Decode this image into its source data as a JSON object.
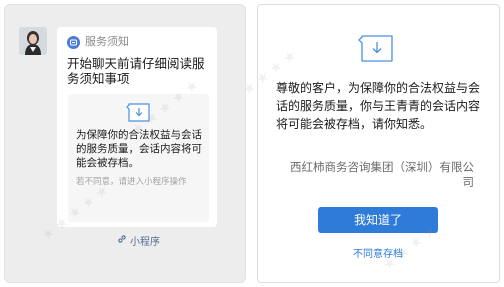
{
  "chat_preview": {
    "service_name": "服务须知",
    "title": "开始聊天前请仔细阅读服务须知事项",
    "card_text": "为保障你的合法权益与会话的服务质量，会话内容将可能会被存档。",
    "card_note": "若不同意，请进入小程序操作",
    "mini_program_label": "小程序"
  },
  "dialog": {
    "notice": "尊敬的客户，为保障你的合法权益与会话的服务质量，你与王青青的会话内容将可能会被存档，请你知悉。",
    "company": "西红柿商务咨询集团（深圳）有限公司",
    "agree_button": "我知道了",
    "disagree_link": "不同意存档"
  },
  "colors": {
    "accent": "#2e7bd9",
    "link": "#576b95",
    "panel_bg": "#ededed"
  },
  "icons": {
    "service": "notice-icon",
    "document": "archive-download-icon",
    "link": "mini-program-link-icon"
  }
}
